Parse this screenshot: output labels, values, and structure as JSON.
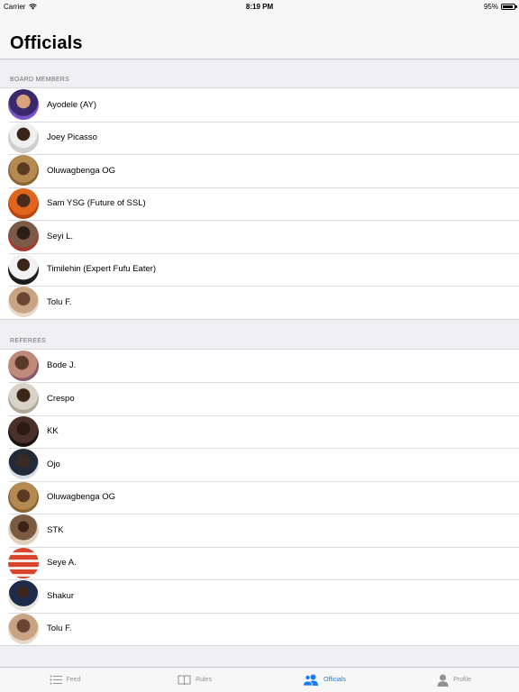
{
  "status": {
    "carrier": "Carrier",
    "time": "8:19 PM",
    "battery": "95%",
    "battery_level": 0.95
  },
  "nav": {
    "title": "Officials"
  },
  "sections": [
    {
      "header": "BOARD MEMBERS",
      "items": [
        {
          "name": "Ayodele (AY)"
        },
        {
          "name": "Joey Picasso"
        },
        {
          "name": "Oluwagbenga OG"
        },
        {
          "name": "Sam YSG (Future of SSL)"
        },
        {
          "name": "Seyi L."
        },
        {
          "name": "Timilehin (Expert Fufu Eater)"
        },
        {
          "name": "Tolu F."
        }
      ]
    },
    {
      "header": "REFEREES",
      "items": [
        {
          "name": "Bode J."
        },
        {
          "name": "Crespo"
        },
        {
          "name": "KK"
        },
        {
          "name": "Ojo"
        },
        {
          "name": "Oluwagbenga OG"
        },
        {
          "name": "STK"
        },
        {
          "name": "Seye A."
        },
        {
          "name": "Shakur"
        },
        {
          "name": "Tolu F."
        }
      ]
    }
  ],
  "tabs": [
    {
      "label": "Feed",
      "icon": "list-icon",
      "active": false
    },
    {
      "label": "Rules",
      "icon": "book-icon",
      "active": false
    },
    {
      "label": "Officials",
      "icon": "people-icon",
      "active": true
    },
    {
      "label": "Profile",
      "icon": "person-icon",
      "active": false
    }
  ],
  "colors": {
    "accent": "#1a7cf2",
    "inactive": "#929292",
    "background": "#efeff4"
  }
}
